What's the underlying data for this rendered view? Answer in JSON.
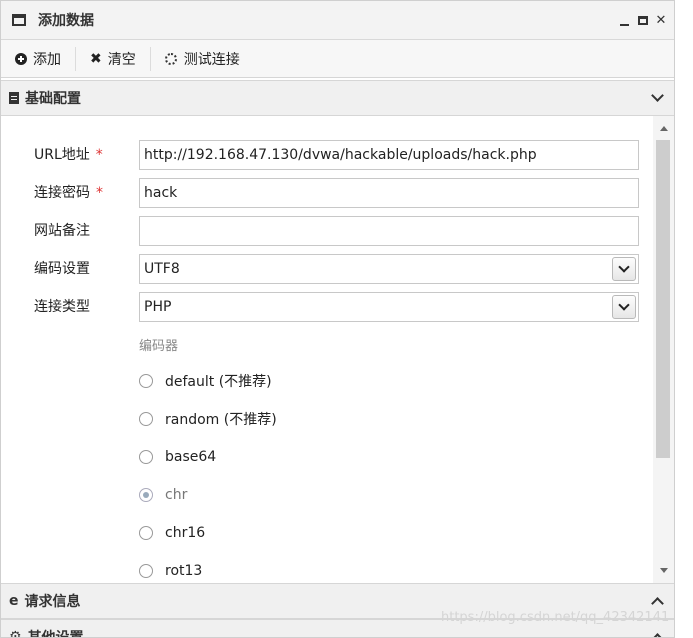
{
  "window": {
    "title": "添加数据",
    "controls": [
      "minimize",
      "maximize",
      "close"
    ]
  },
  "toolbar": {
    "add_label": "添加",
    "clear_label": "清空",
    "test_label": "测试连接"
  },
  "sections": {
    "basic": "基础配置",
    "request": "请求信息",
    "other": "其他设置"
  },
  "form": {
    "url_label": "URL地址",
    "url_value": "http://192.168.47.130/dvwa/hackable/uploads/hack.php",
    "password_label": "连接密码",
    "password_value": "hack",
    "note_label": "网站备注",
    "note_value": "",
    "encoding_label": "编码设置",
    "encoding_value": "UTF8",
    "type_label": "连接类型",
    "type_value": "PHP",
    "required_mark": "*"
  },
  "encoder": {
    "title": "编码器",
    "options": [
      "default (不推荐)",
      "random (不推荐)",
      "base64",
      "chr",
      "chr16",
      "rot13"
    ],
    "selected": "chr"
  },
  "watermark": "https://blog.csdn.net/qq_42342141",
  "icons": {
    "window": "window-icon",
    "add": "plus-circle-icon",
    "clear": "close-icon",
    "test": "spinner-icon",
    "basic": "document-icon",
    "request": "ie-icon",
    "other": "gears-icon"
  }
}
